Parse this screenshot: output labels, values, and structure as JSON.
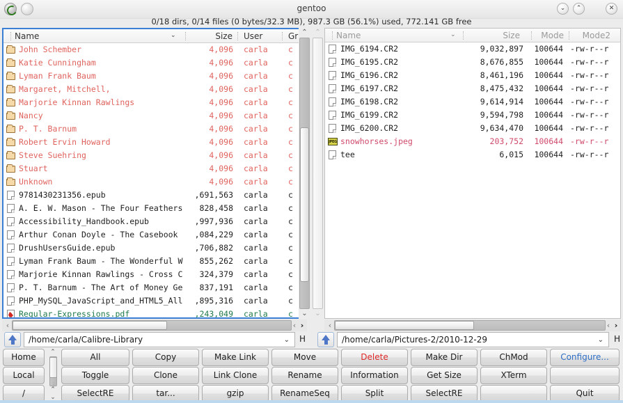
{
  "window": {
    "title": "gentoo",
    "status": "0/18 dirs, 0/14 files (0 bytes/32.3 MB), 987.3 GB (56.1%) used, 772.141 GB free",
    "buttons": {
      "minimize": "⌄",
      "maximize": "⌃",
      "close": "✕"
    }
  },
  "left_panel": {
    "columns": [
      {
        "label": "Name",
        "align": "left"
      },
      {
        "label": "Size",
        "align": "right"
      },
      {
        "label": "User",
        "align": "left"
      },
      {
        "label": "Gr",
        "align": "left"
      }
    ],
    "sort_caret": "⌄",
    "path": "/home/carla/Calibre-Library",
    "path_caret": "⌄",
    "h_label": "H",
    "rows": [
      {
        "icon": "folder-icon",
        "kind": "dir",
        "name": "John Schember",
        "size": "4,096",
        "user": "carla",
        "group": "c"
      },
      {
        "icon": "folder-icon",
        "kind": "dir",
        "name": "Katie Cunningham",
        "size": "4,096",
        "user": "carla",
        "group": "c"
      },
      {
        "icon": "folder-icon",
        "kind": "dir",
        "name": "Lyman Frank Baum",
        "size": "4,096",
        "user": "carla",
        "group": "c"
      },
      {
        "icon": "folder-icon",
        "kind": "dir",
        "name": "Margaret, Mitchell,",
        "size": "4,096",
        "user": "carla",
        "group": "c"
      },
      {
        "icon": "folder-icon",
        "kind": "dir",
        "name": "Marjorie Kinnan Rawlings",
        "size": "4,096",
        "user": "carla",
        "group": "c"
      },
      {
        "icon": "folder-icon",
        "kind": "dir",
        "name": "Nancy",
        "size": "4,096",
        "user": "carla",
        "group": "c"
      },
      {
        "icon": "folder-icon",
        "kind": "dir",
        "name": "P. T. Barnum",
        "size": "4,096",
        "user": "carla",
        "group": "c"
      },
      {
        "icon": "folder-icon",
        "kind": "dir",
        "name": "Robert Ervin Howard",
        "size": "4,096",
        "user": "carla",
        "group": "c"
      },
      {
        "icon": "folder-icon",
        "kind": "dir",
        "name": "Steve Suehring",
        "size": "4,096",
        "user": "carla",
        "group": "c"
      },
      {
        "icon": "folder-icon",
        "kind": "dir",
        "name": "Stuart",
        "size": "4,096",
        "user": "carla",
        "group": "c"
      },
      {
        "icon": "folder-icon",
        "kind": "dir",
        "name": "Unknown",
        "size": "4,096",
        "user": "carla",
        "group": "c"
      },
      {
        "icon": "file-icon",
        "kind": "file",
        "name": "9781430231356.epub",
        "size": ",691,563",
        "user": "carla",
        "group": "c"
      },
      {
        "icon": "file-icon",
        "kind": "file",
        "name": "A. E. W. Mason - The Four Feathers",
        "size": "828,458",
        "user": "carla",
        "group": "c"
      },
      {
        "icon": "file-icon",
        "kind": "file",
        "name": "Accessibility_Handbook.epub",
        "size": ",997,936",
        "user": "carla",
        "group": "c"
      },
      {
        "icon": "file-icon",
        "kind": "file",
        "name": "Arthur Conan Doyle - The Casebook",
        "size": ",084,229",
        "user": "carla",
        "group": "c"
      },
      {
        "icon": "file-icon",
        "kind": "file",
        "name": "DrushUsersGuide.epub",
        "size": ",706,882",
        "user": "carla",
        "group": "c"
      },
      {
        "icon": "file-icon",
        "kind": "file",
        "name": "Lyman Frank Baum - The Wonderful W",
        "size": "855,262",
        "user": "carla",
        "group": "c"
      },
      {
        "icon": "file-icon",
        "kind": "file",
        "name": "Marjorie Kinnan Rawlings - Cross C",
        "size": "324,379",
        "user": "carla",
        "group": "c"
      },
      {
        "icon": "file-icon",
        "kind": "file",
        "name": "P. T. Barnum - The Art of Money Ge",
        "size": "837,191",
        "user": "carla",
        "group": "c"
      },
      {
        "icon": "file-icon",
        "kind": "file",
        "name": "PHP_MySQL_JavaScript_and_HTML5_All",
        "size": ",895,316",
        "user": "carla",
        "group": "c"
      },
      {
        "icon": "pdf-icon",
        "kind": "pdf",
        "name": "Regular-Expressions.pdf",
        "size": ",243,049",
        "user": "carla",
        "group": "c"
      }
    ]
  },
  "right_panel": {
    "columns": [
      {
        "label": "Name",
        "align": "left"
      },
      {
        "label": "Size",
        "align": "right"
      },
      {
        "label": "Mode",
        "align": "right"
      },
      {
        "label": "Mode2",
        "align": "right"
      }
    ],
    "sort_caret": "⌄",
    "path": "/home/carla/Pictures-2/2010-12-29",
    "path_caret": "⌄",
    "h_label": "H",
    "rows": [
      {
        "icon": "file-icon",
        "kind": "file",
        "name": "IMG_6194.CR2",
        "size": "9,032,897",
        "mode": "100644",
        "mode2": "-rw-r--r"
      },
      {
        "icon": "file-icon",
        "kind": "file",
        "name": "IMG_6195.CR2",
        "size": "8,676,855",
        "mode": "100644",
        "mode2": "-rw-r--r"
      },
      {
        "icon": "file-icon",
        "kind": "file",
        "name": "IMG_6196.CR2",
        "size": "8,461,196",
        "mode": "100644",
        "mode2": "-rw-r--r"
      },
      {
        "icon": "file-icon",
        "kind": "file",
        "name": "IMG_6197.CR2",
        "size": "8,475,432",
        "mode": "100644",
        "mode2": "-rw-r--r"
      },
      {
        "icon": "file-icon",
        "kind": "file",
        "name": "IMG_6198.CR2",
        "size": "9,614,914",
        "mode": "100644",
        "mode2": "-rw-r--r"
      },
      {
        "icon": "file-icon",
        "kind": "file",
        "name": "IMG_6199.CR2",
        "size": "9,594,798",
        "mode": "100644",
        "mode2": "-rw-r--r"
      },
      {
        "icon": "file-icon",
        "kind": "file",
        "name": "IMG_6200.CR2",
        "size": "9,634,470",
        "mode": "100644",
        "mode2": "-rw-r--r"
      },
      {
        "icon": "jpeg-icon",
        "kind": "img",
        "name": "snowhorses.jpeg",
        "size": "203,752",
        "mode": "100644",
        "mode2": "-rw-r--r"
      },
      {
        "icon": "file-icon",
        "kind": "file",
        "name": "tee",
        "size": "6,015",
        "mode": "100644",
        "mode2": "-rw-r--r"
      }
    ]
  },
  "side_buttons": [
    {
      "label": "Home"
    },
    {
      "label": "Local"
    },
    {
      "label": "/"
    }
  ],
  "command_buttons": [
    {
      "label": "All",
      "style": "normal"
    },
    {
      "label": "Copy",
      "style": "normal"
    },
    {
      "label": "Make Link",
      "style": "normal"
    },
    {
      "label": "Move",
      "style": "normal"
    },
    {
      "label": "Delete",
      "style": "danger"
    },
    {
      "label": "Make Dir",
      "style": "normal"
    },
    {
      "label": "ChMod",
      "style": "normal"
    },
    {
      "label": "Configure...",
      "style": "link"
    },
    {
      "label": "Toggle",
      "style": "normal"
    },
    {
      "label": "Clone",
      "style": "normal"
    },
    {
      "label": "Link Clone",
      "style": "normal"
    },
    {
      "label": "Rename",
      "style": "normal"
    },
    {
      "label": "Information",
      "style": "normal"
    },
    {
      "label": "Get Size",
      "style": "normal"
    },
    {
      "label": "XTerm",
      "style": "normal"
    },
    {
      "label": "",
      "style": "normal"
    },
    {
      "label": "SelectRE",
      "style": "normal"
    },
    {
      "label": "tar...",
      "style": "normal"
    },
    {
      "label": "gzip",
      "style": "normal"
    },
    {
      "label": "RenameSeq",
      "style": "normal"
    },
    {
      "label": "Split",
      "style": "normal"
    },
    {
      "label": "SelectRE",
      "style": "normal"
    },
    {
      "label": "",
      "style": "normal"
    },
    {
      "label": "Quit",
      "style": "normal"
    }
  ],
  "scroll": {
    "up_arrow": "⌃",
    "down_arrow": "⌄",
    "left_arrow": "‹",
    "right_arrow": "›"
  }
}
